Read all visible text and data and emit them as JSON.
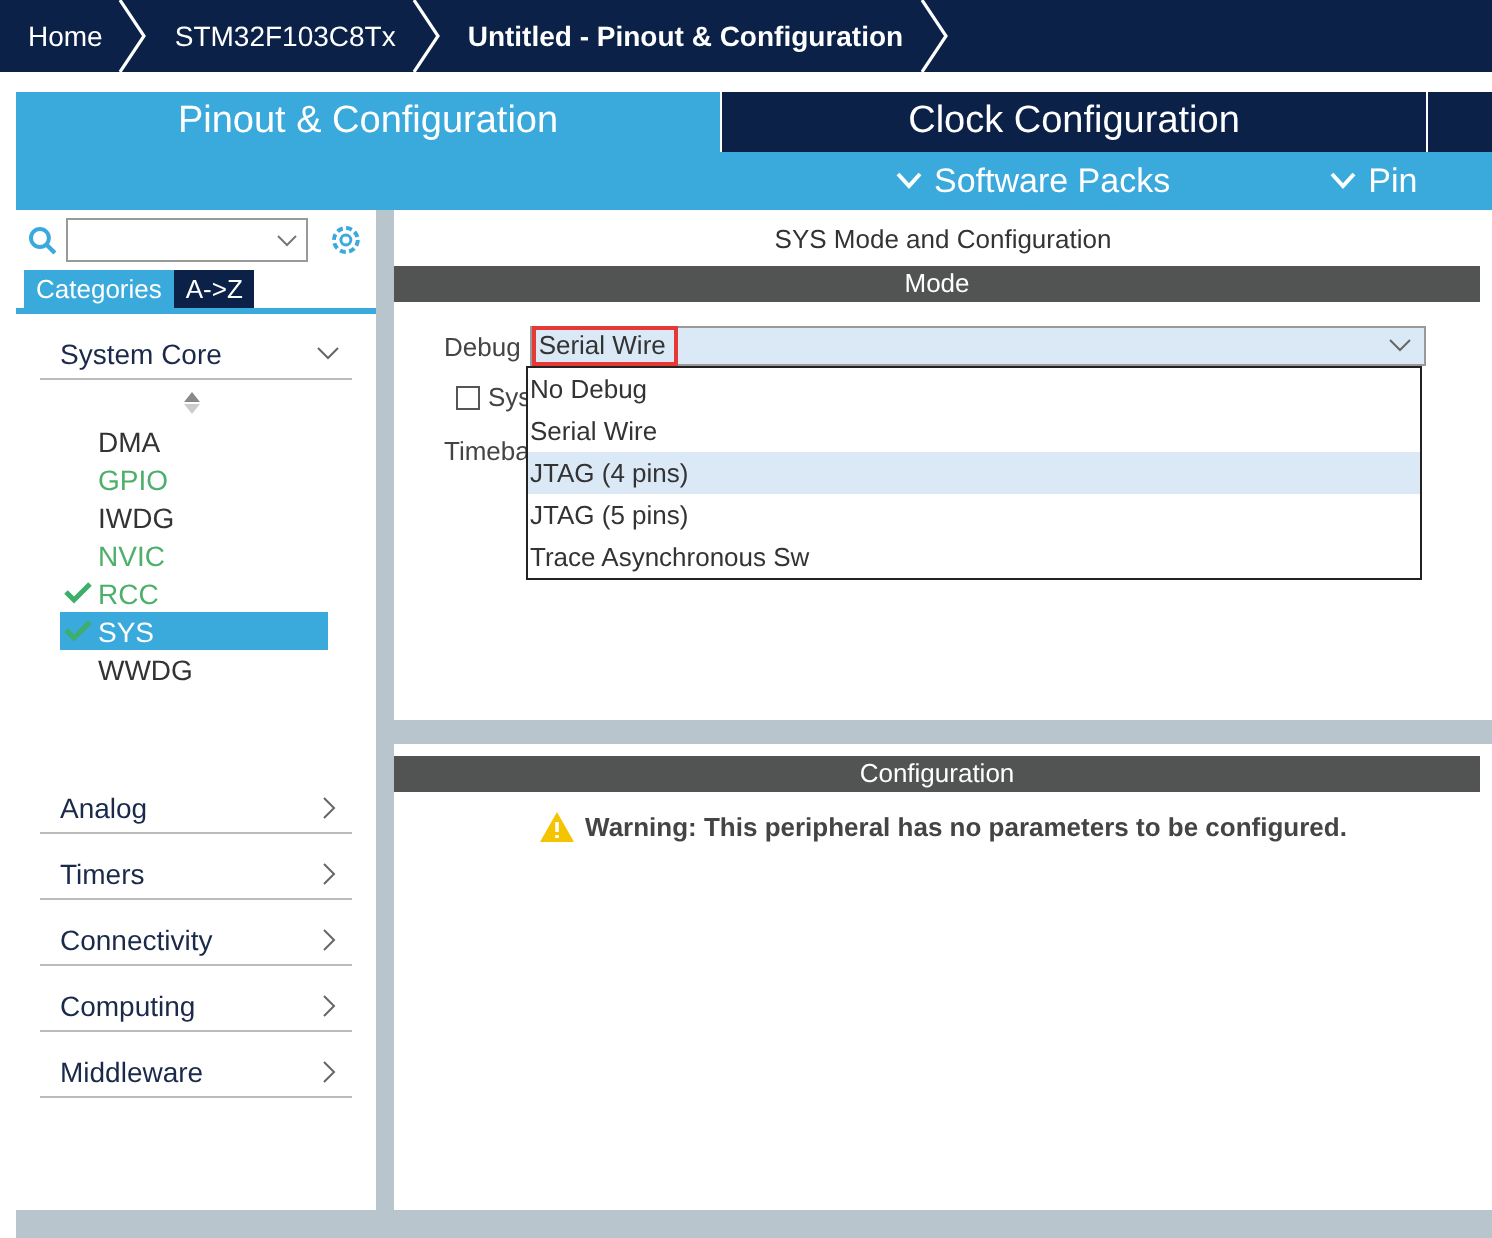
{
  "breadcrumb": [
    {
      "label": "Home",
      "current": false
    },
    {
      "label": "STM32F103C8Tx",
      "current": false
    },
    {
      "label": "Untitled - Pinout & Configuration",
      "current": true
    }
  ],
  "tabs": [
    {
      "label": "Pinout & Configuration",
      "selected": true
    },
    {
      "label": "Clock Configuration",
      "selected": false
    }
  ],
  "subtabs": [
    "Software Packs",
    "Pin"
  ],
  "sidebar": {
    "view_tabs": [
      {
        "label": "Categories",
        "selected": true
      },
      {
        "label": "A->Z",
        "selected": false
      }
    ],
    "groups": [
      {
        "label": "System Core",
        "expanded": true,
        "items": [
          {
            "label": "DMA",
            "color": "#333333",
            "checked": false,
            "selected": false
          },
          {
            "label": "GPIO",
            "color": "#4caf6a",
            "checked": false,
            "selected": false
          },
          {
            "label": "IWDG",
            "color": "#333333",
            "checked": false,
            "selected": false
          },
          {
            "label": "NVIC",
            "color": "#4caf6a",
            "checked": false,
            "selected": false
          },
          {
            "label": "RCC",
            "color": "#4caf6a",
            "checked": true,
            "selected": false
          },
          {
            "label": "SYS",
            "color": "#ffffff",
            "checked": true,
            "selected": true
          },
          {
            "label": "WWDG",
            "color": "#333333",
            "checked": false,
            "selected": false
          }
        ]
      },
      {
        "label": "Analog",
        "expanded": false
      },
      {
        "label": "Timers",
        "expanded": false
      },
      {
        "label": "Connectivity",
        "expanded": false
      },
      {
        "label": "Computing",
        "expanded": false
      },
      {
        "label": "Middleware",
        "expanded": false
      }
    ]
  },
  "mode_panel": {
    "title": "SYS Mode and Configuration",
    "header": "Mode",
    "debug_label": "Debug",
    "debug_value": "Serial Wire",
    "checkbox_label": "Sys",
    "checkbox_checked": false,
    "timebase_label": "Timeba",
    "options": [
      {
        "label": "No Debug",
        "selected": false
      },
      {
        "label": "Serial Wire",
        "selected": false
      },
      {
        "label": "JTAG (4 pins)",
        "selected": true
      },
      {
        "label": "JTAG (5 pins)",
        "selected": false
      },
      {
        "label": "Trace Asynchronous Sw",
        "selected": false
      }
    ]
  },
  "config_panel": {
    "header": "Configuration",
    "warning": "Warning: This peripheral has no parameters to be configured."
  }
}
